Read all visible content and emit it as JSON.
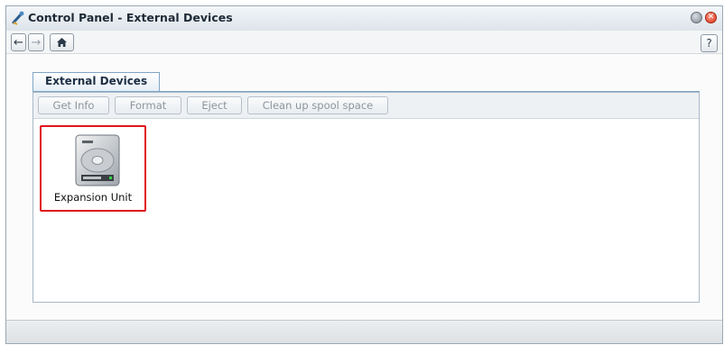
{
  "window": {
    "title": "Control Panel - External Devices",
    "app_icon": "control-panel-icon",
    "close_glyph": "✕"
  },
  "nav": {
    "back_icon": "←",
    "forward_icon": "→",
    "home_icon": "⌂",
    "help_label": "?"
  },
  "tabs": [
    {
      "label": "External Devices",
      "active": true
    }
  ],
  "toolbar": {
    "get_info": "Get Info",
    "format": "Format",
    "eject": "Eject",
    "cleanup": "Clean up spool space"
  },
  "devices": [
    {
      "label": "Expansion Unit",
      "icon": "hard-drive-icon",
      "selected": true
    }
  ],
  "colors": {
    "selection_border": "#e0161b",
    "tab_accent": "#7fa5c6",
    "close_button": "#d9331b"
  }
}
